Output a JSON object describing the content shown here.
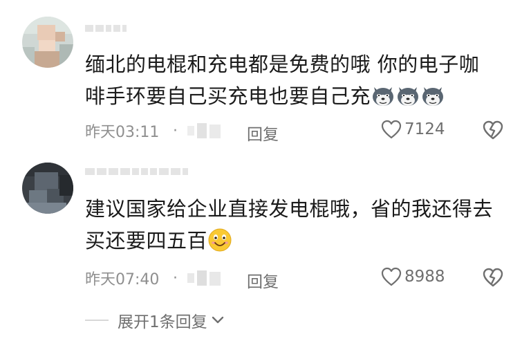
{
  "comments": [
    {
      "text_line1": "缅北的电棍和充电都是免费的哦 你的电子咖",
      "text_line2": "啡手环要自己买充电也要自己充",
      "emoji": "dog-face-emoji",
      "emoji_count": 3,
      "time": "昨天03:11",
      "separator": "·",
      "reply_label": "回复",
      "likes": "7124"
    },
    {
      "text_line1": "建议国家给企业直接发电棍哦，省的我还得去",
      "text_line2": "买还要四五百",
      "emoji": "smile-emoji",
      "emoji_count": 1,
      "time": "昨天07:40",
      "separator": "·",
      "reply_label": "回复",
      "likes": "8988"
    }
  ],
  "expand_replies": "展开1条回复",
  "colors": {
    "text": "#1a1a1a",
    "meta": "#8f8f8f",
    "icon": "#6f6f6f"
  }
}
